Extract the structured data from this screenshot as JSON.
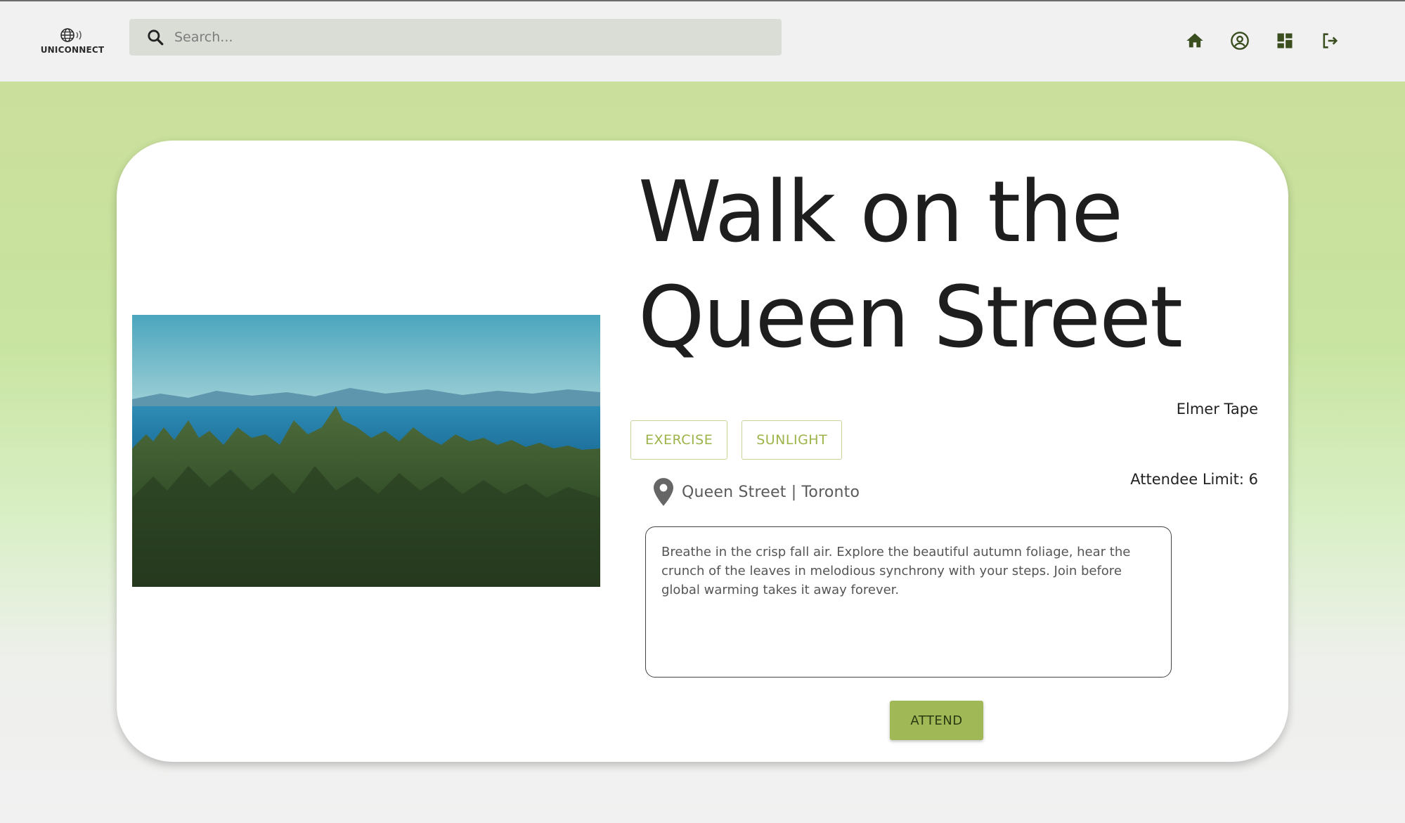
{
  "app": {
    "logo_text": "UNICONNECT"
  },
  "header": {
    "search_placeholder": "Search...",
    "nav_icons": [
      "home-icon",
      "account-circle-icon",
      "dashboard-icon",
      "logout-icon"
    ]
  },
  "event": {
    "title_line1": "Walk on the",
    "title_line2": "Queen Street",
    "host": "Elmer Tape",
    "tags": [
      "EXERCISE",
      "SUNLIGHT"
    ],
    "location": "Queen Street | Toronto",
    "attendee_limit": "Attendee Limit: 6",
    "description": "Breathe in the crisp fall air. Explore the beautiful autumn foliage, hear the crunch of the leaves in melodious synchrony with your steps. Join before global warming takes it away forever.",
    "attend_label": "ATTEND"
  },
  "colors": {
    "accent": "#a0b856",
    "tag_text": "#9cb449",
    "icon_dark": "#3a4e1f",
    "bg_gradient_top": "#cadf9b"
  }
}
